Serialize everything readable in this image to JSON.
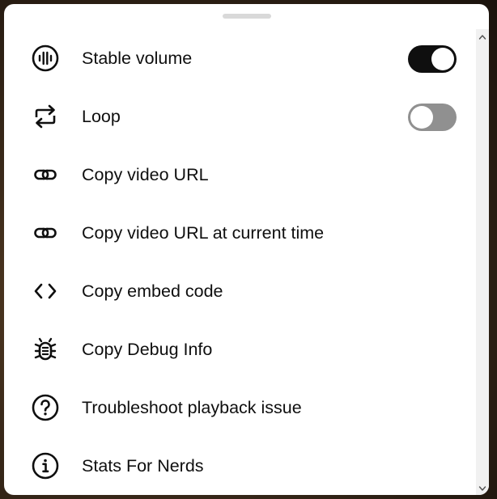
{
  "menu": {
    "items": [
      {
        "label": "Stable volume",
        "icon": "stable-volume-icon",
        "toggle": "on"
      },
      {
        "label": "Loop",
        "icon": "loop-icon",
        "toggle": "off"
      },
      {
        "label": "Copy video URL",
        "icon": "link-icon"
      },
      {
        "label": "Copy video URL at current time",
        "icon": "link-icon"
      },
      {
        "label": "Copy embed code",
        "icon": "code-icon"
      },
      {
        "label": "Copy Debug Info",
        "icon": "bug-icon"
      },
      {
        "label": "Troubleshoot playback issue",
        "icon": "help-circle-icon"
      },
      {
        "label": "Stats For Nerds",
        "icon": "info-circle-icon"
      }
    ]
  },
  "colors": {
    "text": "#0f0f0f",
    "toggle_on": "#0f0f0f",
    "toggle_off": "#909090",
    "sheet_bg": "#ffffff"
  }
}
